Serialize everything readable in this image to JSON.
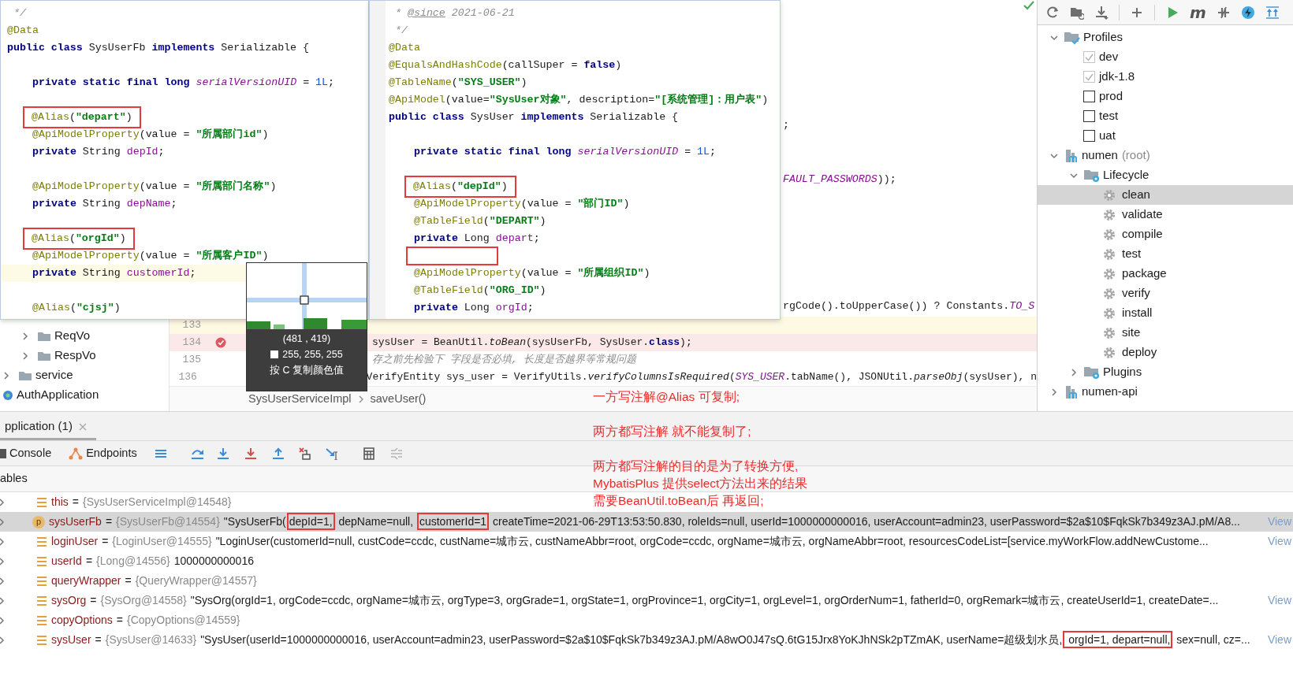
{
  "popups": [
    {
      "lines": [
        {
          "kind": "code",
          "tokens": [
            {
              "kind": "cmt",
              "text": " */"
            }
          ]
        },
        {
          "kind": "code",
          "tokens": [
            {
              "kind": "ann",
              "text": "@Data"
            }
          ]
        },
        {
          "kind": "code",
          "tokens": [
            {
              "kind": "kw",
              "text": "public class"
            },
            {
              "kind": "p",
              "text": " SysUserFb "
            },
            {
              "kind": "kw",
              "text": "implements"
            },
            {
              "kind": "p",
              "text": " Serializable {"
            }
          ]
        },
        {
          "kind": "blank"
        },
        {
          "kind": "code",
          "member": true,
          "tokens": [
            {
              "kind": "kw",
              "text": "private static final long"
            },
            {
              "kind": "ital",
              "text": " serialVersionUID"
            },
            {
              "kind": "p",
              "text": " = "
            },
            {
              "kind": "num",
              "text": "1L"
            },
            {
              "kind": "p",
              "text": ";"
            }
          ]
        },
        {
          "kind": "blank"
        },
        {
          "kind": "code",
          "member": true,
          "boxed": true,
          "tokens": [
            {
              "kind": "ann",
              "text": "@Alias"
            },
            {
              "kind": "p",
              "text": "("
            },
            {
              "kind": "str",
              "text": "\"depart\""
            },
            {
              "kind": "p",
              "text": ")"
            }
          ]
        },
        {
          "kind": "code",
          "member": true,
          "tokens": [
            {
              "kind": "ann",
              "text": "@ApiModelProperty"
            },
            {
              "kind": "p",
              "text": "(value = "
            },
            {
              "kind": "str",
              "text": "\"所属部门id\""
            },
            {
              "kind": "p",
              "text": ")"
            }
          ]
        },
        {
          "kind": "code",
          "member": true,
          "tokens": [
            {
              "kind": "kw",
              "text": "private"
            },
            {
              "kind": "p",
              "text": " String "
            },
            {
              "kind": "fld",
              "text": "depId"
            },
            {
              "kind": "p",
              "text": ";"
            }
          ]
        },
        {
          "kind": "blank"
        },
        {
          "kind": "code",
          "member": true,
          "tokens": [
            {
              "kind": "ann",
              "text": "@ApiModelProperty"
            },
            {
              "kind": "p",
              "text": "(value = "
            },
            {
              "kind": "str",
              "text": "\"所属部门名称\""
            },
            {
              "kind": "p",
              "text": ")"
            }
          ]
        },
        {
          "kind": "code",
          "member": true,
          "tokens": [
            {
              "kind": "kw",
              "text": "private"
            },
            {
              "kind": "p",
              "text": " String "
            },
            {
              "kind": "fld",
              "text": "depName"
            },
            {
              "kind": "p",
              "text": ";"
            }
          ]
        },
        {
          "kind": "blank"
        },
        {
          "kind": "code",
          "member": true,
          "boxed": true,
          "tokens": [
            {
              "kind": "ann",
              "text": "@Alias"
            },
            {
              "kind": "p",
              "text": "("
            },
            {
              "kind": "str",
              "text": "\"orgId\""
            },
            {
              "kind": "p",
              "text": ")"
            }
          ]
        },
        {
          "kind": "code",
          "member": true,
          "tokens": [
            {
              "kind": "ann",
              "text": "@ApiModelProperty"
            },
            {
              "kind": "p",
              "text": "(value = "
            },
            {
              "kind": "str",
              "text": "\"所属客户ID\""
            },
            {
              "kind": "p",
              "text": ")"
            }
          ]
        },
        {
          "kind": "code",
          "member": true,
          "highlighted": true,
          "tokens": [
            {
              "kind": "kw",
              "text": "private"
            },
            {
              "kind": "p",
              "text": " String "
            },
            {
              "kind": "fld",
              "text": "customerId"
            },
            {
              "kind": "p",
              "text": ";"
            }
          ]
        },
        {
          "kind": "blank"
        },
        {
          "kind": "code",
          "member": true,
          "tokens": [
            {
              "kind": "ann",
              "text": "@Alias"
            },
            {
              "kind": "p",
              "text": "("
            },
            {
              "kind": "str",
              "text": "\"cjsj\""
            },
            {
              "kind": "p",
              "text": ")"
            }
          ]
        }
      ]
    },
    {
      "lines": [
        {
          "kind": "code",
          "tokens": [
            {
              "kind": "cmt",
              "text": " * "
            },
            {
              "kind": "doc",
              "text": "@since"
            },
            {
              "kind": "cmt",
              "text": " 2021-06-21"
            }
          ]
        },
        {
          "kind": "code",
          "tokens": [
            {
              "kind": "cmt",
              "text": " */"
            }
          ]
        },
        {
          "kind": "code",
          "tokens": [
            {
              "kind": "ann",
              "text": "@Data"
            }
          ]
        },
        {
          "kind": "code",
          "tokens": [
            {
              "kind": "ann",
              "text": "@EqualsAndHashCode"
            },
            {
              "kind": "p",
              "text": "(callSuper = "
            },
            {
              "kind": "kw",
              "text": "false"
            },
            {
              "kind": "p",
              "text": ")"
            }
          ]
        },
        {
          "kind": "code",
          "tokens": [
            {
              "kind": "ann",
              "text": "@TableName"
            },
            {
              "kind": "p",
              "text": "("
            },
            {
              "kind": "str",
              "text": "\"SYS_USER\""
            },
            {
              "kind": "p",
              "text": ")"
            }
          ]
        },
        {
          "kind": "code",
          "tokens": [
            {
              "kind": "ann",
              "text": "@ApiModel"
            },
            {
              "kind": "p",
              "text": "(value="
            },
            {
              "kind": "str",
              "text": "\"SysUser对象\""
            },
            {
              "kind": "p",
              "text": ", description="
            },
            {
              "kind": "str",
              "text": "\"[系统管理]：用户表\""
            },
            {
              "kind": "p",
              "text": ")"
            }
          ]
        },
        {
          "kind": "code",
          "tokens": [
            {
              "kind": "kw",
              "text": "public class"
            },
            {
              "kind": "p",
              "text": " SysUser "
            },
            {
              "kind": "kw",
              "text": "implements"
            },
            {
              "kind": "p",
              "text": " Serializable {"
            }
          ]
        },
        {
          "kind": "blank"
        },
        {
          "kind": "code",
          "member": true,
          "tokens": [
            {
              "kind": "kw",
              "text": "private static final long"
            },
            {
              "kind": "ital",
              "text": " serialVersionUID"
            },
            {
              "kind": "p",
              "text": " = "
            },
            {
              "kind": "num",
              "text": "1L"
            },
            {
              "kind": "p",
              "text": ";"
            }
          ]
        },
        {
          "kind": "blank"
        },
        {
          "kind": "code",
          "member": true,
          "boxed": true,
          "tokens": [
            {
              "kind": "ann",
              "text": "@Alias"
            },
            {
              "kind": "p",
              "text": "("
            },
            {
              "kind": "str",
              "text": "\"depId\""
            },
            {
              "kind": "p",
              "text": ")"
            }
          ]
        },
        {
          "kind": "code",
          "member": true,
          "tokens": [
            {
              "kind": "ann",
              "text": "@ApiModelProperty"
            },
            {
              "kind": "p",
              "text": "(value = "
            },
            {
              "kind": "str",
              "text": "\"部门ID\""
            },
            {
              "kind": "p",
              "text": ")"
            }
          ]
        },
        {
          "kind": "code",
          "member": true,
          "tokens": [
            {
              "kind": "ann",
              "text": "@TableField"
            },
            {
              "kind": "p",
              "text": "("
            },
            {
              "kind": "str",
              "text": "\"DEPART\""
            },
            {
              "kind": "p",
              "text": ")"
            }
          ]
        },
        {
          "kind": "code",
          "member": true,
          "tokens": [
            {
              "kind": "kw",
              "text": "private"
            },
            {
              "kind": "p",
              "text": " Long "
            },
            {
              "kind": "fld",
              "text": "depart"
            },
            {
              "kind": "p",
              "text": ";"
            }
          ]
        },
        {
          "kind": "blank",
          "member": true,
          "boxed": true
        },
        {
          "kind": "code",
          "member": true,
          "tokens": [
            {
              "kind": "ann",
              "text": "@ApiModelProperty"
            },
            {
              "kind": "p",
              "text": "(value = "
            },
            {
              "kind": "str",
              "text": "\"所属组织ID\""
            },
            {
              "kind": "p",
              "text": ")"
            }
          ]
        },
        {
          "kind": "code",
          "member": true,
          "tokens": [
            {
              "kind": "ann",
              "text": "@TableField"
            },
            {
              "kind": "p",
              "text": "("
            },
            {
              "kind": "str",
              "text": "\"ORG_ID\""
            },
            {
              "kind": "p",
              "text": ")"
            }
          ]
        },
        {
          "kind": "code",
          "member": true,
          "tokens": [
            {
              "kind": "kw",
              "text": "private"
            },
            {
              "kind": "p",
              "text": " Long "
            },
            {
              "kind": "fld",
              "text": "orgId"
            },
            {
              "kind": "p",
              "text": ";"
            }
          ]
        }
      ]
    }
  ],
  "editor": {
    "background_fragments": [
      {
        "tokens": [
          {
            "kind": "p",
            "text": ";"
          }
        ]
      },
      {
        "tokens": [
          {
            "kind": "ital",
            "text": "FAULT_PASSWORDS"
          },
          {
            "kind": "p",
            "text": "));"
          }
        ]
      },
      {
        "tokens": [
          {
            "kind": "p",
            "text": "rgCode().toUpperCase()) ? Constants."
          },
          {
            "kind": "ital",
            "text": "TO_S"
          }
        ]
      }
    ],
    "lines": [
      {
        "number": "133",
        "highlighted": true,
        "breakpoint": false
      },
      {
        "number": "134",
        "highlighted": false,
        "breakpoint": true,
        "tokens": [
          {
            "kind": "p",
            "text": "sysUser = BeanUtil."
          },
          {
            "kind": "sm",
            "text": "toBean"
          },
          {
            "kind": "p",
            "text": "(sysUserFb, SysUser."
          },
          {
            "kind": "kw",
            "text": "class"
          },
          {
            "kind": "p",
            "text": ");"
          }
        ]
      },
      {
        "number": "135",
        "highlighted": false,
        "breakpoint": false,
        "tokens": [
          {
            "kind": "cmt",
            "text": "存之前先检验下 字段是否必填, 长度是否越界等常规问题"
          }
        ]
      },
      {
        "number": "136",
        "highlighted": false,
        "breakpoint": false,
        "tokens": [
          {
            "kind": "p",
            "text": "VerifyEntity sys_user = VerifyUtils."
          },
          {
            "kind": "sm",
            "text": "verifyColumnsIsRequired"
          },
          {
            "kind": "p",
            "text": "("
          },
          {
            "kind": "ital",
            "text": "SYS_USER"
          },
          {
            "kind": "p",
            "text": ".tabName(), JSONUtil."
          },
          {
            "kind": "sm",
            "text": "parseObj"
          },
          {
            "kind": "p",
            "text": "(sysUser), n"
          }
        ]
      }
    ],
    "breadcrumb": [
      "SysUserServiceImpl",
      "saveUser()"
    ]
  },
  "color_picker": {
    "coords": "(481 , 419)",
    "rgb": "255, 255, 255",
    "hint": "按 C 复制颜色值"
  },
  "project_tree": {
    "items": [
      {
        "children": [
          {
            "label": "ReqVo",
            "kind": "folder",
            "expanded": false
          },
          {
            "label": "RespVo",
            "kind": "folder",
            "expanded": false
          }
        ]
      },
      {
        "label": "service",
        "kind": "folder",
        "expanded": false
      },
      {
        "label": "AuthApplication",
        "kind": "class"
      }
    ]
  },
  "maven": {
    "toolbar_label": "m",
    "tree": [
      {
        "label": "Profiles",
        "kind": "profiles",
        "expanded": true,
        "selected": false,
        "children": [
          {
            "label": "dev",
            "kind": "profile",
            "checked": true,
            "selected": false
          },
          {
            "label": "jdk-1.8",
            "kind": "profile",
            "checked": true,
            "selected": false
          },
          {
            "label": "prod",
            "kind": "profile",
            "checked": false,
            "selected": false
          },
          {
            "label": "test",
            "kind": "profile",
            "checked": false,
            "selected": false
          },
          {
            "label": "uat",
            "kind": "profile",
            "checked": false,
            "selected": false
          }
        ]
      },
      {
        "label": "numen",
        "suffix": "(root)",
        "kind": "module",
        "expanded": true,
        "selected": false,
        "children": [
          {
            "label": "Lifecycle",
            "kind": "group",
            "expanded": true,
            "selected": false,
            "children": [
              {
                "label": "clean",
                "kind": "goal",
                "selected": true
              },
              {
                "label": "validate",
                "kind": "goal",
                "selected": false
              },
              {
                "label": "compile",
                "kind": "goal",
                "selected": false
              },
              {
                "label": "test",
                "kind": "goal",
                "selected": false
              },
              {
                "label": "package",
                "kind": "goal",
                "selected": false
              },
              {
                "label": "verify",
                "kind": "goal",
                "selected": false
              },
              {
                "label": "install",
                "kind": "goal",
                "selected": false
              },
              {
                "label": "site",
                "kind": "goal",
                "selected": false
              },
              {
                "label": "deploy",
                "kind": "goal",
                "selected": false
              }
            ]
          },
          {
            "label": "Plugins",
            "kind": "group",
            "expanded": false,
            "selected": false
          }
        ]
      },
      {
        "label": "numen-api",
        "kind": "module",
        "expanded": false,
        "selected": false
      }
    ]
  },
  "notes": [
    [
      "一方写注解@Alias 可复制;"
    ],
    [
      "两方都写注解 就不能复制了;"
    ],
    [
      "两方都写注解的目的是为了转换方便,",
      "MybatisPlus 提供select方法出来的结果",
      "需要BeanUtil.toBean后 再返回;"
    ]
  ],
  "debug": {
    "tab": "pplication (1)",
    "toolbar": [
      "Console",
      "Endpoints"
    ],
    "variables_header": "ables",
    "variables": [
      {
        "name": "this",
        "separator": "=",
        "type": "{SysUserServiceImpl@14548}",
        "kind": "field",
        "selected": false
      },
      {
        "name": "sysUserFb",
        "separator": "=",
        "type": "{SysUserFb@14554}",
        "kind": "param",
        "badge": "p",
        "selected": true,
        "value": [
          {
            "text": "\"SysUserFb("
          },
          {
            "text": "depId=1,",
            "boxed": true
          },
          {
            "text": " depName=null, "
          },
          {
            "text": "customerId=1",
            "boxed": true
          },
          {
            "text": " createTime=2021-06-29T13:53:50.830, roleIds=null, userId=1000000000016, userAccount=admin23, userPassword=$2a$10$FqkSk7b349z3AJ.pM/A8..."
          }
        ],
        "view": "View"
      },
      {
        "name": "loginUser",
        "separator": "=",
        "type": "{LoginUser@14555}",
        "kind": "field",
        "selected": false,
        "value": "\"LoginUser(customerId=null, custCode=ccdc, custName=城市云, custNameAbbr=root, orgCode=ccdc, orgName=城市云, orgNameAbbr=root, resourcesCodeList=[service.myWorkFlow.addNewCustome...",
        "view": "View"
      },
      {
        "name": "userId",
        "separator": "=",
        "type": "{Long@14556}",
        "kind": "field",
        "selected": false,
        "value": "1000000000016"
      },
      {
        "name": "queryWrapper",
        "separator": "=",
        "type": "{QueryWrapper@14557}",
        "kind": "field",
        "selected": false
      },
      {
        "name": "sysOrg",
        "separator": "=",
        "type": "{SysOrg@14558}",
        "kind": "field",
        "selected": false,
        "value": "\"SysOrg(orgId=1, orgCode=ccdc, orgName=城市云, orgType=3, orgGrade=1, orgState=1, orgProvince=1, orgCity=1, orgLevel=1, orgOrderNum=1, fatherId=0, orgRemark=城市云, createUserId=1, createDate=...",
        "view": "View"
      },
      {
        "name": "copyOptions",
        "separator": "=",
        "type": "{CopyOptions@14559}",
        "kind": "field",
        "selected": false
      },
      {
        "name": "sysUser",
        "separator": "=",
        "type": "{SysUser@14633}",
        "kind": "field",
        "selected": false,
        "value": [
          {
            "text": "\"SysUser(userId=1000000000016, userAccount=admin23, userPassword=$2a$10$FqkSk7b349z3AJ.pM/A8wO0J47sQ.6tG15Jrx8YoKJhNSk2pTZmAK, userName=超级划水员,"
          },
          {
            "text": " orgId=1, depart=null,",
            "boxed": true
          },
          {
            "text": " sex=null, cz=..."
          }
        ],
        "view": "View"
      }
    ]
  }
}
